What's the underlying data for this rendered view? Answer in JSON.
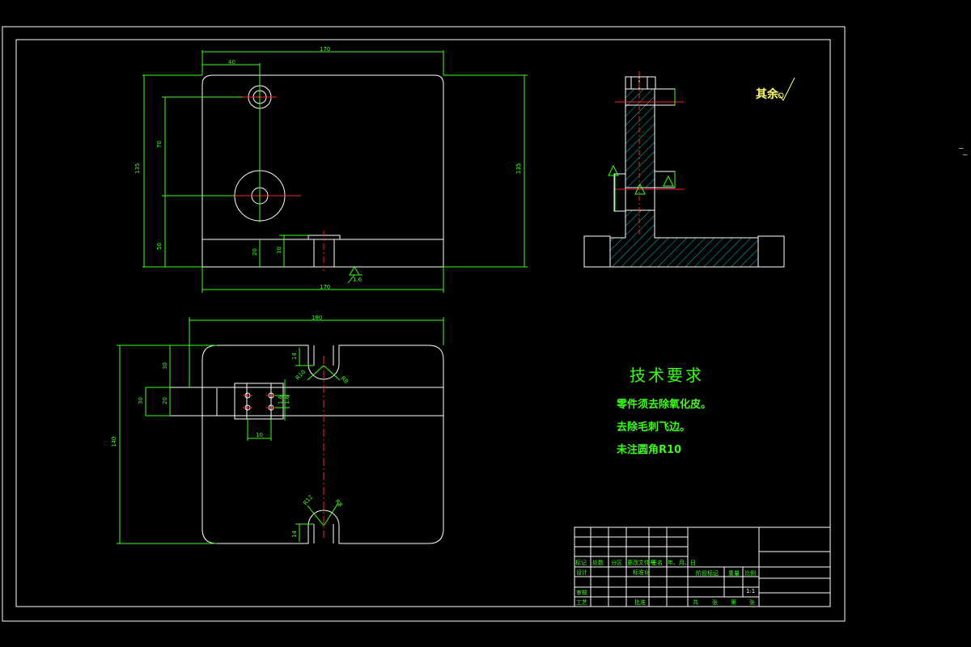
{
  "drawing": {
    "tech_requirements": {
      "title": "技术要求",
      "lines": [
        "零件须去除氧化皮。",
        "去除毛刺飞边。",
        "未注圆角R10"
      ]
    },
    "roughness_note": "其余",
    "dimensions": {
      "top_view": {
        "width_top": "170",
        "offset_left": "40",
        "height_left": "135",
        "height_right": "135",
        "mid_v": "70",
        "low_v": "50",
        "slot_depth": "20",
        "slot_h": "10",
        "width_bottom": "170",
        "roughness": "1.6"
      },
      "bottom_view": {
        "width_top": "180",
        "height_total": "140",
        "v1": "30",
        "v2": "20",
        "v3": "30",
        "hole_spacing": "10",
        "slot_w": "14",
        "r1": "R10",
        "r2": "R8",
        "slot_w_bottom": "14",
        "r3": "R12",
        "r4": "R8",
        "side_a": "1.6",
        "side_b": "1.6"
      }
    },
    "title_block": {
      "row_labels": [
        "标记",
        "处数",
        "分区",
        "更改文件号",
        "签名",
        "年、月、日"
      ],
      "design": "设计",
      "standardize": "标准化",
      "review": "审核",
      "process": "工艺",
      "approve": "批准",
      "stage_mark": "阶段标记",
      "weight": "重量",
      "scale_label": "比例",
      "scale_value": "1:1",
      "sheets": "共",
      "sheet_of": "张",
      "page": "第",
      "page_of": "张"
    }
  }
}
